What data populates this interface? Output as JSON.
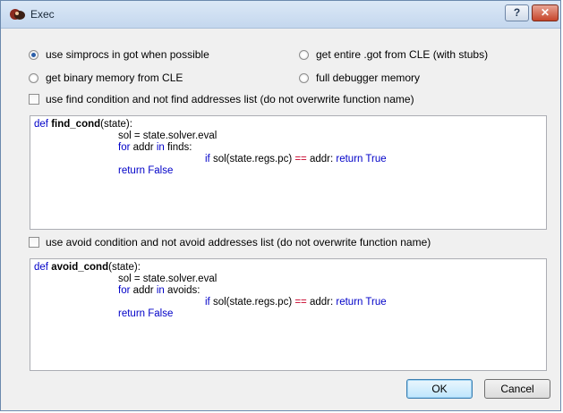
{
  "window": {
    "title": "Exec",
    "help_label": "?",
    "close_label": "✕"
  },
  "options": {
    "radio_got": "use simprocs in got when possible",
    "radio_entire_got": "get entire .got from CLE (with stubs)",
    "radio_binary": "get binary memory from CLE",
    "radio_full_debugger": "full debugger memory",
    "find_checkbox": "use find condition and not find addresses list (do not overwrite function name)",
    "avoid_checkbox": "use avoid condition and not avoid addresses list (do not overwrite function name)"
  },
  "find_code": {
    "def_kw": "def",
    "fn_name": "find_cond",
    "params": "(state):",
    "l2": "sol = state.solver.eval",
    "l3_kw": "for",
    "l3_a": " addr ",
    "l3_in": "in",
    "l3_b": " finds:",
    "l4_kw": "if",
    "l4_a": " sol(state.regs.pc) ",
    "l4_op": "==",
    "l4_b": " addr: ",
    "l4_ret": "return True",
    "l5": "return False"
  },
  "avoid_code": {
    "def_kw": "def",
    "fn_name": "avoid_cond",
    "params": "(state):",
    "l2": "sol = state.solver.eval",
    "l3_kw": "for",
    "l3_a": " addr ",
    "l3_in": "in",
    "l3_b": " avoids:",
    "l4_kw": "if",
    "l4_a": " sol(state.regs.pc) ",
    "l4_op": "==",
    "l4_b": " addr: ",
    "l4_ret": "return True",
    "l5": "return False"
  },
  "buttons": {
    "ok": "OK",
    "cancel": "Cancel"
  },
  "colors": {
    "keyword": "#0000c8",
    "operator": "#c8002a",
    "accent": "#3c7fb1"
  }
}
